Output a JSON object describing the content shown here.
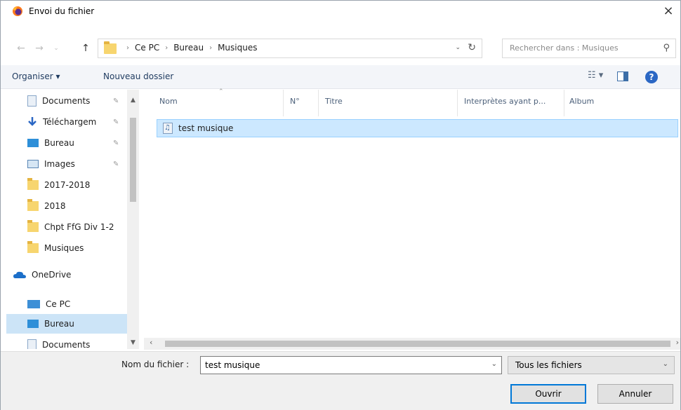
{
  "window": {
    "title": "Envoi du fichier",
    "close_glyph": "×"
  },
  "address": {
    "crumbs": [
      "Ce PC",
      "Bureau",
      "Musiques"
    ],
    "search_placeholder": "Rechercher dans : Musiques"
  },
  "toolbar": {
    "organiser": "Organiser ▾",
    "new_folder": "Nouveau dossier",
    "help": "?"
  },
  "sidebar": {
    "items": [
      {
        "label": "Documents",
        "icon": "document-icon",
        "pinned": true
      },
      {
        "label": "Téléchargem",
        "icon": "download-icon",
        "pinned": true
      },
      {
        "label": "Bureau",
        "icon": "desktop-icon",
        "pinned": true
      },
      {
        "label": "Images",
        "icon": "pictures-icon",
        "pinned": true
      },
      {
        "label": "2017-2018",
        "icon": "folder-icon",
        "pinned": false
      },
      {
        "label": "2018",
        "icon": "folder-icon",
        "pinned": false
      },
      {
        "label": "Chpt FfG Div 1-2",
        "icon": "folder-icon",
        "pinned": false
      },
      {
        "label": "Musiques",
        "icon": "folder-icon",
        "pinned": false
      },
      {
        "label": "OneDrive",
        "icon": "onedrive-icon",
        "pinned": false
      },
      {
        "label": "Ce PC",
        "icon": "pc-icon",
        "pinned": false
      },
      {
        "label": "Bureau",
        "icon": "desktop-icon",
        "pinned": false,
        "selected": true
      },
      {
        "label": "Documents",
        "icon": "document-icon",
        "pinned": false
      }
    ]
  },
  "filelist": {
    "columns": [
      "Nom",
      "N°",
      "Titre",
      "Interprètes ayant p...",
      "Album"
    ],
    "rows": [
      {
        "name": "test musique",
        "selected": true
      }
    ]
  },
  "footer": {
    "filename_label": "Nom du fichier :",
    "filename_value": "test musique",
    "filetype_value": "Tous les fichiers",
    "open_label": "Ouvrir",
    "cancel_label": "Annuler"
  }
}
